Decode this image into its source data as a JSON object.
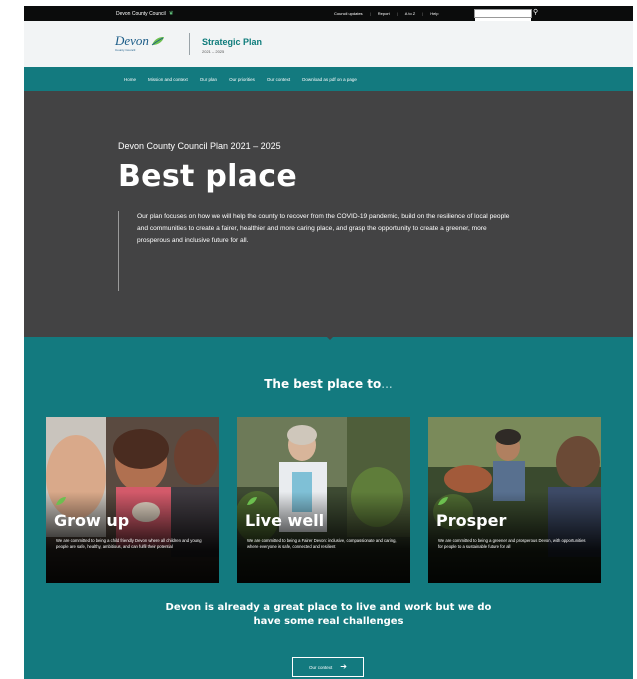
{
  "topbar": {
    "brand": "Devon County Council",
    "links": [
      "Council updates",
      "Report",
      "A to Z",
      "Help"
    ],
    "search_placeholder": ""
  },
  "header": {
    "logo_word": "Devon",
    "logo_sub": "County Council",
    "site_title": "Strategic Plan",
    "site_years": "2021 – 2025"
  },
  "nav": {
    "items": [
      "Home",
      "Mission and context",
      "Our plan",
      "Our priorities",
      "Our context",
      "Download as pdf on a page"
    ]
  },
  "hero": {
    "kicker": "Devon County Council Plan 2021 – 2025",
    "title": "Best place",
    "quote": "Our plan focuses on how we will help the county to recover from the COVID-19 pandemic, build on the resilience of local people and communities to create a fairer, healthier and more caring place, and grasp the opportunity to create a greener, more prosperous and inclusive future for all."
  },
  "section": {
    "heading": "The best place to",
    "heading_suffix": "...",
    "cards": [
      {
        "title": "Grow up",
        "text": "We are committed to being a child friendly Devon where all children and young people are safe, healthy, ambitious, and can fulfil their potential"
      },
      {
        "title": "Live well",
        "text": "We are committed to being a Fairer Devon: inclusive, compassionate and caring, where everyone is safe, connected and resilient"
      },
      {
        "title": "Prosper",
        "text": "We are committed to being a greener and prosperous Devon, with opportunities for people to a sustainable future for all"
      }
    ],
    "challenge_line1": "Devon is already a great place to live and work but we do",
    "challenge_line2": "have some real challenges",
    "cta_label": "Our context"
  },
  "colors": {
    "teal": "#137a7f",
    "hero_grey": "#434344",
    "topbar_black": "#0b0c0c"
  }
}
